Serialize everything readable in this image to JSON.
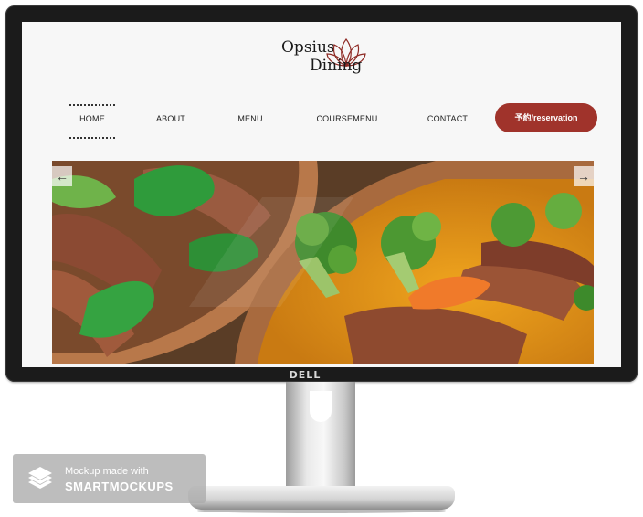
{
  "device": {
    "brand": "DELL"
  },
  "site": {
    "logo": {
      "line1": "Opsius",
      "line2": "Dining"
    },
    "nav": [
      {
        "label": "HOME",
        "active": true
      },
      {
        "label": "ABOUT",
        "active": false
      },
      {
        "label": "MENU",
        "active": false
      },
      {
        "label": "COURSEMENU",
        "active": false
      },
      {
        "label": "CONTACT",
        "active": false
      }
    ],
    "reservation_label": "予約/reservation",
    "slider": {
      "prev_icon": "←",
      "next_icon": "→"
    }
  },
  "watermark": {
    "line1": "Mockup made with",
    "line2": "SMARTMOCKUPS"
  },
  "colors": {
    "accent": "#a0332b",
    "bezel": "#1b1b1b",
    "screen_bg": "#f7f7f7"
  }
}
